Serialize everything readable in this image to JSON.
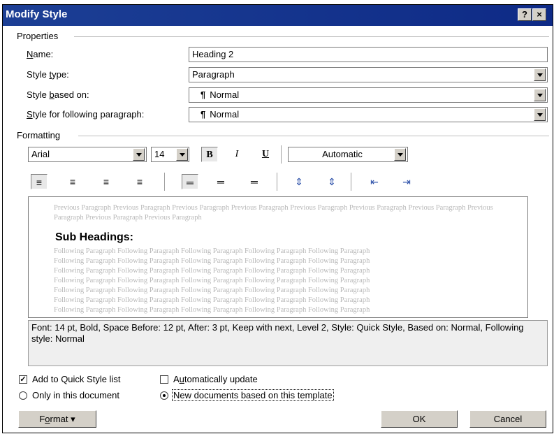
{
  "window": {
    "title": "Modify Style",
    "help_btn": "?",
    "close_btn": "×"
  },
  "properties": {
    "group_label": "Properties",
    "name_label": "Name:",
    "name_value": "Heading 2",
    "type_label": "Style type:",
    "type_value": "Paragraph",
    "based_label": "Style based on:",
    "based_value": "Normal",
    "following_label": "Style for following paragraph:",
    "following_value": "Normal"
  },
  "formatting": {
    "group_label": "Formatting",
    "font_name": "Arial",
    "font_size": "14",
    "bold_label": "B",
    "italic_label": "I",
    "underline_label": "U",
    "color_value": "Automatic"
  },
  "preview": {
    "previous_paragraph": "Previous Paragraph Previous Paragraph Previous Paragraph Previous Paragraph Previous Paragraph Previous Paragraph Previous Paragraph Previous Paragraph Previous Paragraph Previous Paragraph",
    "sample_heading": "Sub Headings:",
    "following_lines": [
      "Following Paragraph Following Paragraph Following Paragraph Following Paragraph Following Paragraph",
      "Following Paragraph Following Paragraph Following Paragraph Following Paragraph Following Paragraph",
      "Following Paragraph Following Paragraph Following Paragraph Following Paragraph Following Paragraph",
      "Following Paragraph Following Paragraph Following Paragraph Following Paragraph Following Paragraph",
      "Following Paragraph Following Paragraph Following Paragraph Following Paragraph Following Paragraph",
      "Following Paragraph Following Paragraph Following Paragraph Following Paragraph Following Paragraph",
      "Following Paragraph Following Paragraph Following Paragraph Following Paragraph Following Paragraph"
    ]
  },
  "description": "Font: 14 pt, Bold, Space Before:  12 pt, After:  3 pt, Keep with next, Level 2, Style: Quick Style, Based on: Normal, Following style: Normal",
  "options": {
    "quick_style_label": "Add to Quick Style list",
    "quick_style_checked": true,
    "auto_update_label": "Automatically update",
    "auto_update_checked": false,
    "only_doc_label": "Only in this document",
    "new_docs_label": "New documents based on this template",
    "selected_scope": "new_docs"
  },
  "buttons": {
    "format": "Format",
    "ok": "OK",
    "cancel": "Cancel"
  }
}
